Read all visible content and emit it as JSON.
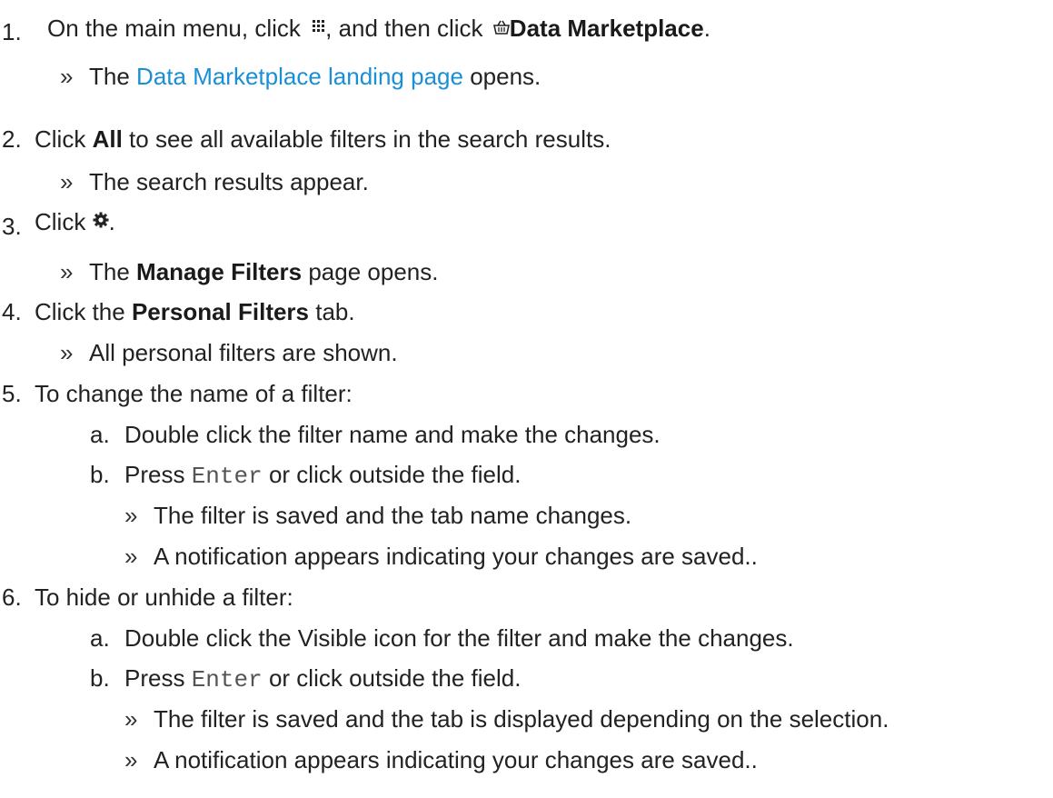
{
  "steps": {
    "s1": {
      "number": "1.",
      "text_a": "On the main menu, click",
      "text_b": ", and then click",
      "strong": "Data Marketplace",
      "tail": ".",
      "icon_menu": "grid-menu-icon",
      "icon_market": "basket-icon",
      "result": {
        "marker": "»",
        "pre": "The",
        "link": "Data Marketplace landing page",
        "post": "opens."
      }
    },
    "s2": {
      "number": "2.",
      "pre": "Click",
      "strong": "All",
      "post": "to see all available filters in the search results.",
      "result": {
        "marker": "»",
        "text": "The search results appear."
      }
    },
    "s3": {
      "number": "3.",
      "pre": "Click",
      "tail": ".",
      "icon": "gear-icon",
      "result": {
        "marker": "»",
        "pre": "The",
        "strong": "Manage Filters",
        "post": "page opens."
      }
    },
    "s4": {
      "number": "4.",
      "pre": "Click the",
      "strong": "Personal Filters",
      "post": "tab.",
      "result": {
        "marker": "»",
        "text": "All personal filters are shown."
      }
    },
    "s5": {
      "number": "5.",
      "text": "To change the name of a filter:",
      "a": {
        "letter": "a.",
        "text": "Double click the filter name and make the changes."
      },
      "b": {
        "letter": "b.",
        "pre": "Press",
        "code": "Enter",
        "post": "or click outside the field."
      },
      "r1": {
        "marker": "»",
        "text": "The filter is saved and the tab name changes."
      },
      "r2": {
        "marker": "»",
        "text": "A notification appears indicating your changes are saved.."
      }
    },
    "s6": {
      "number": "6.",
      "text": "To hide or unhide a filter:",
      "a": {
        "letter": "a.",
        "text": "Double click the Visible icon for the filter and make the changes."
      },
      "b": {
        "letter": "b.",
        "pre": "Press",
        "code": "Enter",
        "post": "or click outside the field."
      },
      "r1": {
        "marker": "»",
        "text": "The filter is saved and the tab is displayed depending on the selection."
      },
      "r2": {
        "marker": "»",
        "text": "A notification appears indicating your changes are saved.."
      }
    }
  },
  "colors": {
    "text": "#222222",
    "link": "#1a8fd6",
    "code": "#555555"
  }
}
